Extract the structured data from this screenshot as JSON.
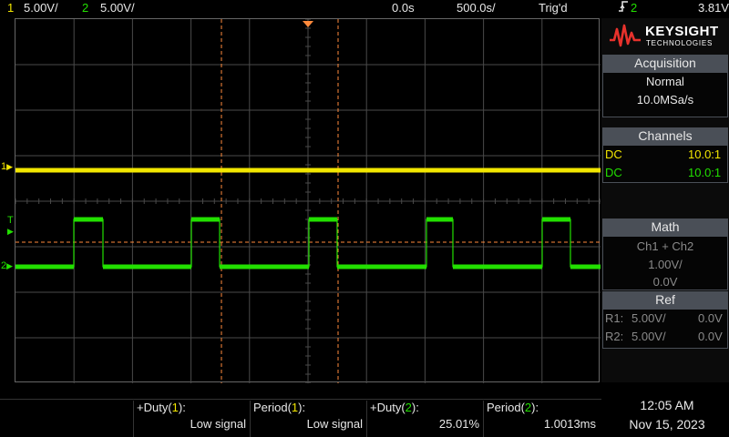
{
  "topbar": {
    "ch1_num": "1",
    "ch1_scale": "5.00V/",
    "ch2_num": "2",
    "ch2_scale": "5.00V/",
    "time_offset": "0.0s",
    "time_scale": "500.0s/",
    "trigger_status": "Trig'd",
    "trigger_slope_icon": "edge-trigger-icon",
    "trigger_source": "2",
    "trigger_level": "3.81V"
  },
  "markers": {
    "ch1_marker": "1",
    "ch2_marker": "2",
    "trigger_marker": "T"
  },
  "panel": {
    "brand": "KEYSIGHT",
    "brand_sub": "TECHNOLOGIES",
    "acquisition": {
      "title": "Acquisition",
      "mode": "Normal",
      "rate": "10.0MSa/s"
    },
    "channels": {
      "title": "Channels",
      "rows": [
        {
          "coupling": "DC",
          "probe": "10.0:1",
          "color": "#f2e600"
        },
        {
          "coupling": "DC",
          "probe": "10.0:1",
          "color": "#22e000"
        }
      ]
    },
    "math": {
      "title": "Math",
      "expr": "Ch1 + Ch2",
      "scale": "1.00V/",
      "offset": "0.0V"
    },
    "ref": {
      "title": "Ref",
      "r1_label": "R1:",
      "r1_scale": "5.00V/",
      "r1_offset": "0.0V",
      "r2_label": "R2:",
      "r2_scale": "5.00V/",
      "r2_offset": "0.0V"
    }
  },
  "measurements": [
    {
      "label_pre": "+Duty(",
      "ch": "1",
      "label_post": "):",
      "value": "Low signal",
      "ch_color": "#f2e600"
    },
    {
      "label_pre": "Period(",
      "ch": "1",
      "label_post": "):",
      "value": "Low signal",
      "ch_color": "#f2e600"
    },
    {
      "label_pre": "+Duty(",
      "ch": "2",
      "label_post": "):",
      "value": "25.01%",
      "ch_color": "#22e000"
    },
    {
      "label_pre": "Period(",
      "ch": "2",
      "label_post": "):",
      "value": "1.0013ms",
      "ch_color": "#22e000"
    }
  ],
  "clock": {
    "time": "12:05 AM",
    "date": "Nov 15, 2023"
  },
  "colors": {
    "ch1": "#f2e600",
    "ch2": "#22e000",
    "cursor": "#ff8a3c",
    "grid": "#4a4a4a"
  }
}
